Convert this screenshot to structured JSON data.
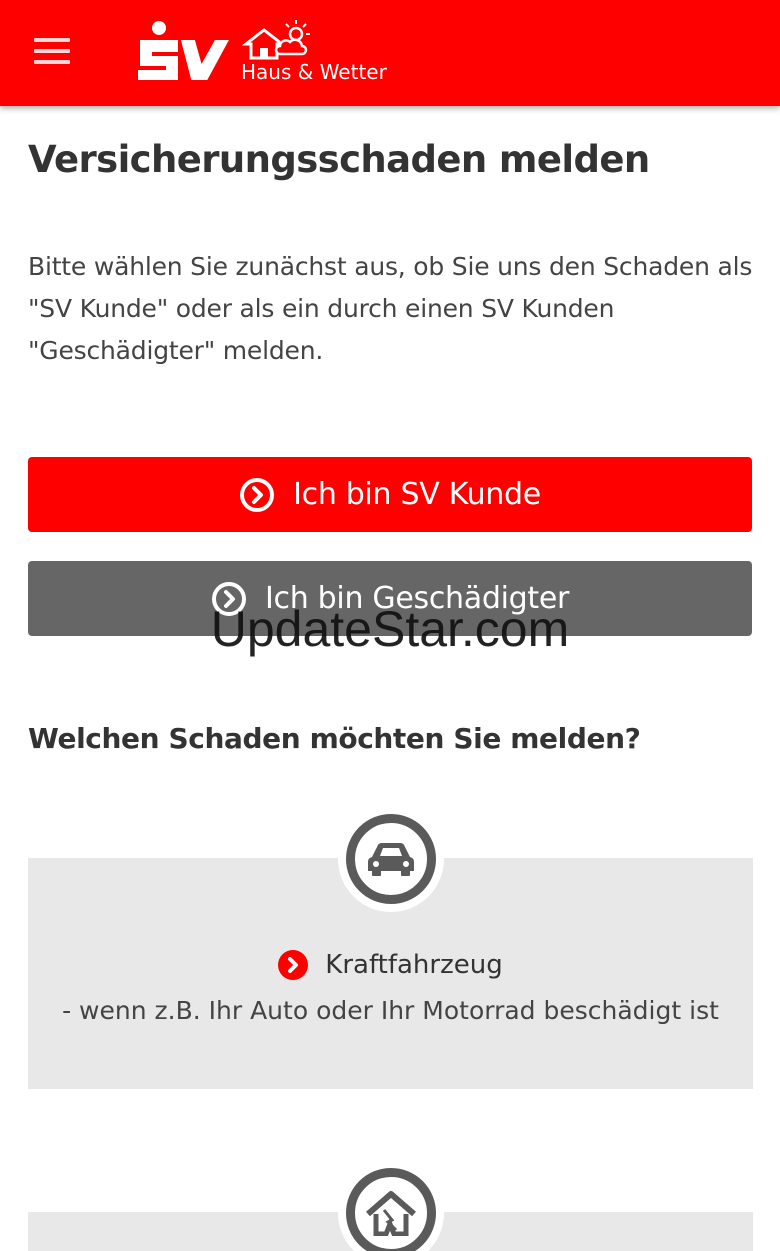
{
  "header": {
    "brand": "SV",
    "subtitle": "Haus & Wetter",
    "menu_icon": "hamburger-menu-icon",
    "bg_color": "#ff0000"
  },
  "main": {
    "title": "Versicherungsschaden melden",
    "intro": "Bitte wählen Sie zunächst aus, ob Sie uns den Schaden als \"SV Kunde\" oder als ein durch einen SV Kunden \"Geschädigter\" melden.",
    "buttons": [
      {
        "label": "Ich bin SV Kunde",
        "icon": "chevron-circle-right-icon",
        "color": "#ff0000"
      },
      {
        "label": "Ich bin Geschädigter",
        "icon": "chevron-circle-right-icon",
        "color": "#666666"
      }
    ],
    "section_title": "Welchen Schaden möchten Sie melden?",
    "damage_types": [
      {
        "icon": "car-icon",
        "label": "Kraftfahrzeug",
        "description": "- wenn z.B. Ihr Auto oder Ihr Motorrad beschädigt ist"
      },
      {
        "icon": "damaged-house-icon"
      }
    ]
  },
  "watermark": "UpdateStar.com"
}
